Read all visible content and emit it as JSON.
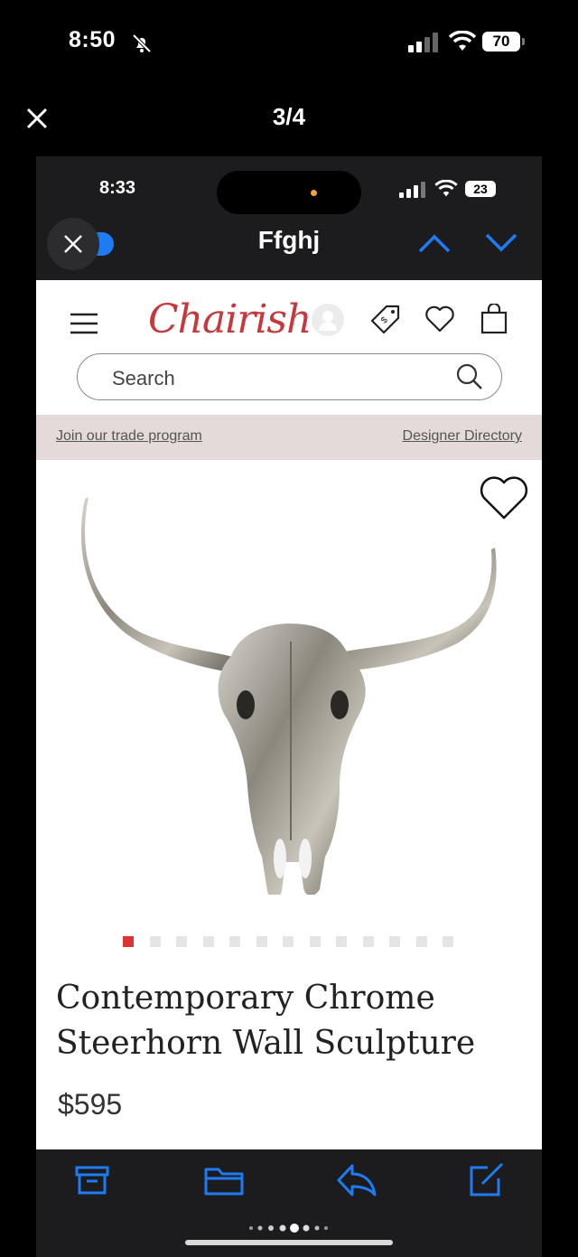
{
  "outer_status": {
    "time": "8:50",
    "battery": "70"
  },
  "viewer": {
    "counter": "3/4"
  },
  "inner_status": {
    "time": "8:33",
    "battery": "23"
  },
  "message": {
    "title": "Ffghj"
  },
  "site": {
    "logo": "Chairish",
    "search": {
      "placeholder": "Search"
    },
    "trade_link": "Join our trade program",
    "designer_link": "Designer Directory"
  },
  "product": {
    "title_line1": "Contemporary Chrome",
    "title_line2": "Steerhorn Wall Sculpture",
    "price": "$595",
    "image_count": 13,
    "active_image": 1
  },
  "colors": {
    "brand": "#c7383d",
    "accent": "#1e7cf2",
    "trade_bar": "#e4dad9"
  },
  "icons": {
    "outer": [
      "bell-slash-icon",
      "signal-icon",
      "wifi-icon",
      "battery-icon",
      "close-icon"
    ],
    "nav": [
      "chevron-up-icon",
      "chevron-down-icon"
    ],
    "site": [
      "hamburger-menu-icon",
      "account-icon",
      "tag-icon",
      "heart-icon",
      "shopping-bag-icon",
      "search-icon"
    ],
    "toolbar": [
      "archive-icon",
      "folder-icon",
      "reply-icon",
      "compose-icon"
    ]
  }
}
